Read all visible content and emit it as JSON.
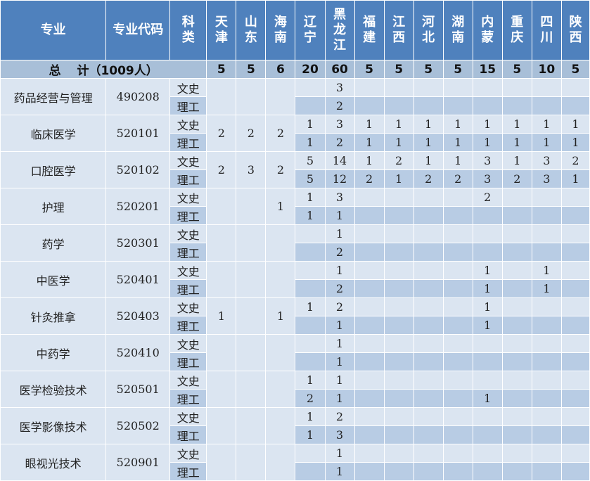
{
  "header": {
    "major": "专业",
    "code": "专业代码",
    "category": "科类",
    "provinces": [
      "天津",
      "山东",
      "海南",
      "辽宁",
      "黑龙江",
      "福建",
      "江西",
      "河北",
      "湖南",
      "内蒙",
      "重庆",
      "四川",
      "陕西"
    ]
  },
  "total": {
    "label": "总　 计（1009人）",
    "values": [
      "5",
      "5",
      "6",
      "20",
      "60",
      "5",
      "5",
      "5",
      "5",
      "15",
      "5",
      "10",
      "5"
    ]
  },
  "rows": [
    {
      "name": "药品经营与管理",
      "code": "490208",
      "merged": [
        "",
        "",
        ""
      ],
      "wenshi": [
        "",
        "3",
        "",
        "",
        "",
        "",
        "",
        "",
        "",
        ""
      ],
      "ligong": [
        "",
        "2",
        "",
        "",
        "",
        "",
        "",
        "",
        "",
        ""
      ]
    },
    {
      "name": "临床医学",
      "code": "520101",
      "merged": [
        "2",
        "2",
        "2"
      ],
      "wenshi": [
        "1",
        "3",
        "1",
        "1",
        "1",
        "1",
        "1",
        "1",
        "1",
        "1"
      ],
      "ligong": [
        "1",
        "2",
        "1",
        "1",
        "1",
        "1",
        "1",
        "1",
        "1",
        "1"
      ]
    },
    {
      "name": "口腔医学",
      "code": "520102",
      "merged": [
        "2",
        "3",
        "2"
      ],
      "wenshi": [
        "5",
        "14",
        "1",
        "2",
        "1",
        "1",
        "3",
        "1",
        "3",
        "2"
      ],
      "ligong": [
        "5",
        "12",
        "2",
        "1",
        "2",
        "2",
        "3",
        "2",
        "3",
        "1"
      ]
    },
    {
      "name": "护理",
      "code": "520201",
      "merged": [
        "",
        "",
        "1"
      ],
      "wenshi": [
        "1",
        "3",
        "",
        "",
        "",
        "",
        "2",
        "",
        "",
        ""
      ],
      "ligong": [
        "1",
        "1",
        "",
        "",
        "",
        "",
        "",
        "",
        "",
        ""
      ]
    },
    {
      "name": "药学",
      "code": "520301",
      "merged": [
        "",
        "",
        ""
      ],
      "wenshi": [
        "",
        "1",
        "",
        "",
        "",
        "",
        "",
        "",
        "",
        ""
      ],
      "ligong": [
        "",
        "2",
        "",
        "",
        "",
        "",
        "",
        "",
        "",
        ""
      ]
    },
    {
      "name": "中医学",
      "code": "520401",
      "merged": [
        "",
        "",
        ""
      ],
      "wenshi": [
        "",
        "1",
        "",
        "",
        "",
        "",
        "1",
        "",
        "1",
        ""
      ],
      "ligong": [
        "",
        "2",
        "",
        "",
        "",
        "",
        "1",
        "",
        "1",
        ""
      ]
    },
    {
      "name": "针灸推拿",
      "code": "520403",
      "merged": [
        "1",
        "",
        "1"
      ],
      "wenshi": [
        "1",
        "2",
        "",
        "",
        "",
        "",
        "1",
        "",
        "",
        ""
      ],
      "ligong": [
        "",
        "1",
        "",
        "",
        "",
        "",
        "1",
        "",
        "",
        ""
      ]
    },
    {
      "name": "中药学",
      "code": "520410",
      "merged": [
        "",
        "",
        ""
      ],
      "wenshi": [
        "",
        "1",
        "",
        "",
        "",
        "",
        "",
        "",
        "",
        ""
      ],
      "ligong": [
        "",
        "1",
        "",
        "",
        "",
        "",
        "",
        "",
        "",
        ""
      ]
    },
    {
      "name": "医学检验技术",
      "code": "520501",
      "merged": [
        "",
        "",
        ""
      ],
      "wenshi": [
        "1",
        "1",
        "",
        "",
        "",
        "",
        "",
        "",
        "",
        ""
      ],
      "ligong": [
        "2",
        "1",
        "",
        "",
        "",
        "",
        "1",
        "",
        "",
        ""
      ]
    },
    {
      "name": "医学影像技术",
      "code": "520502",
      "merged": [
        "",
        "",
        ""
      ],
      "wenshi": [
        "1",
        "2",
        "",
        "",
        "",
        "",
        "",
        "",
        "",
        ""
      ],
      "ligong": [
        "1",
        "3",
        "",
        "",
        "",
        "",
        "",
        "",
        "",
        ""
      ]
    },
    {
      "name": "眼视光技术",
      "code": "520901",
      "merged": [
        "",
        "",
        ""
      ],
      "wenshi": [
        "",
        "1",
        "",
        "",
        "",
        "",
        "",
        "",
        "",
        ""
      ],
      "ligong": [
        "",
        "1",
        "",
        "",
        "",
        "",
        "",
        "",
        "",
        ""
      ]
    }
  ],
  "categories": {
    "wenshi": "文史",
    "ligong": "理工"
  },
  "colors": {
    "header_bg": "#4f81bd",
    "total_bg": "#a8bfd8",
    "row_light": "#dbe5f1",
    "row_dark": "#b8cce4"
  }
}
